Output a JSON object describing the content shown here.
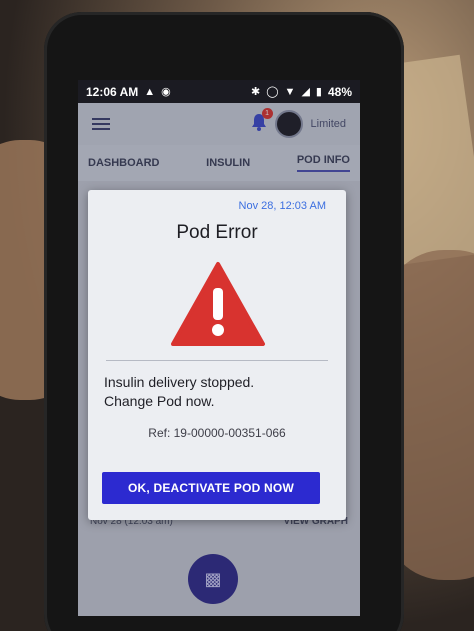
{
  "statusbar": {
    "time": "12:06 AM",
    "battery": "48%"
  },
  "appbar": {
    "notification_count": "1",
    "status_label": "Limited"
  },
  "tabs": [
    {
      "label": "DASHBOARD"
    },
    {
      "label": "INSULIN"
    },
    {
      "label": "POD INFO"
    }
  ],
  "background": {
    "timestamp": "Nov 28 (12:03 am)",
    "view_graph": "VIEW GRAPH"
  },
  "dialog": {
    "timestamp": "Nov 28, 12:03 AM",
    "title": "Pod Error",
    "message_line1": "Insulin delivery stopped.",
    "message_line2": "Change Pod now.",
    "reference": "Ref: 19-00000-00351-066",
    "button_label": "OK, DEACTIVATE POD NOW"
  },
  "colors": {
    "warning": "#d8332f",
    "button": "#2c2ad0",
    "timestamp": "#3c6fe0"
  },
  "icons": {
    "menu": "hamburger-icon",
    "notification": "bell-icon",
    "warning": "warning-triangle-icon",
    "pod": "pod-icon"
  }
}
